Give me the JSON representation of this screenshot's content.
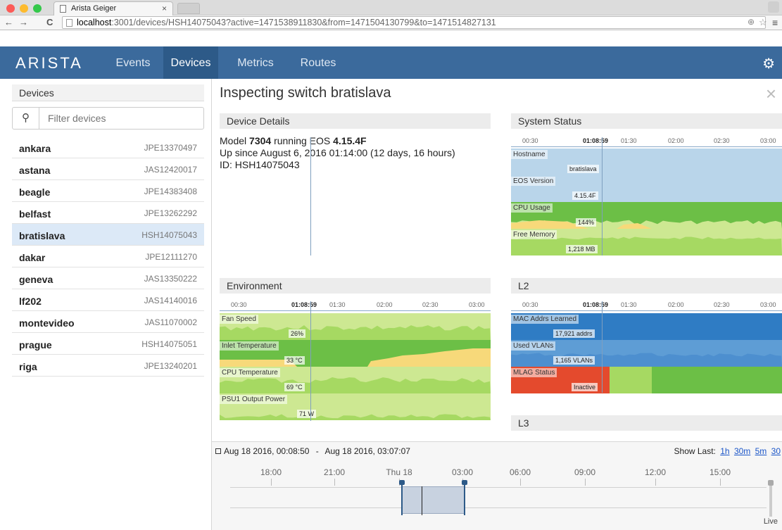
{
  "browser": {
    "tab_title": "Arista Geiger",
    "tab_close": "×",
    "url_host": "localhost",
    "url_rest": ":3001/devices/HSH14075043?active=1471538911830&from=1471504130799&to=1471514827131",
    "back": "←",
    "forward": "→",
    "reload": "C"
  },
  "app": {
    "logo": "ARISTA",
    "menu": [
      "Events",
      "Devices",
      "Metrics",
      "Routes"
    ],
    "active_menu": "Devices",
    "settings_icon": "gear-icon"
  },
  "sidebar": {
    "header": "Devices",
    "search_placeholder": "Filter devices",
    "devices": [
      {
        "name": "ankara",
        "serial": "JPE13370497"
      },
      {
        "name": "astana",
        "serial": "JAS12420017"
      },
      {
        "name": "beagle",
        "serial": "JPE14383408"
      },
      {
        "name": "belfast",
        "serial": "JPE13262292"
      },
      {
        "name": "bratislava",
        "serial": "HSH14075043",
        "selected": true
      },
      {
        "name": "dakar",
        "serial": "JPE12111270"
      },
      {
        "name": "geneva",
        "serial": "JAS13350222"
      },
      {
        "name": "lf202",
        "serial": "JAS14140016"
      },
      {
        "name": "montevideo",
        "serial": "JAS11070002"
      },
      {
        "name": "prague",
        "serial": "HSH14075051"
      },
      {
        "name": "riga",
        "serial": "JPE13240201"
      }
    ]
  },
  "main": {
    "title": "Inspecting switch bratislava",
    "close": "×",
    "device_details": {
      "header": "Device Details",
      "model_pre": "Model ",
      "model": "7304",
      "model_mid": " running EOS ",
      "eos": "4.15.4F",
      "uptime": "Up since August 6, 2016 01:14:00 (12 days, 16 hours)",
      "id": "ID: HSH14075043"
    },
    "axis_ticks": [
      "00:30",
      "01:08:59",
      "01:30",
      "02:00",
      "02:30",
      "03:00"
    ],
    "system_status": {
      "header": "System Status",
      "tracks": [
        {
          "label": "Hostname",
          "value": "bratislava"
        },
        {
          "label": "EOS Version",
          "value": "4.15.4F"
        },
        {
          "label": "CPU Usage",
          "value": "144%"
        },
        {
          "label": "Free Memory",
          "value": "1,218 MB"
        }
      ]
    },
    "environment": {
      "header": "Environment",
      "tracks": [
        {
          "label": "Fan Speed",
          "value": "26%"
        },
        {
          "label": "Inlet Temperature",
          "value": "33 °C"
        },
        {
          "label": "CPU Temperature",
          "value": "69 °C"
        },
        {
          "label": "PSU1 Output Power",
          "value": "71 W"
        }
      ]
    },
    "l2": {
      "header": "L2",
      "tracks": [
        {
          "label": "MAC Addrs Learned",
          "value": "17,921 addrs"
        },
        {
          "label": "Used VLANs",
          "value": "1,165 VLANs"
        },
        {
          "label": "MLAG Status",
          "value": "Inactive"
        }
      ]
    },
    "l3": {
      "header": "L3"
    }
  },
  "timeline": {
    "range_start": "Aug 18 2016, 00:08:50",
    "range_sep": "-",
    "range_end": "Aug 18 2016, 03:07:07",
    "show_last_label": "Show Last:",
    "show_last": [
      "1h",
      "30m",
      "5m",
      "30"
    ],
    "ticks": [
      "18:00",
      "21:00",
      "Thu 18",
      "03:00",
      "06:00",
      "09:00",
      "12:00",
      "15:00"
    ],
    "live": "Live"
  },
  "colors": {
    "appbar": "#3b6a9c",
    "light_green": "#cde892",
    "mid_green": "#a6d962",
    "dark_green": "#6cbf46",
    "yellow": "#f7d97a",
    "light_blue": "#b9d5ea",
    "mid_blue": "#5e9dd5",
    "dark_blue": "#2f7cc4",
    "red": "#e44a2d"
  }
}
